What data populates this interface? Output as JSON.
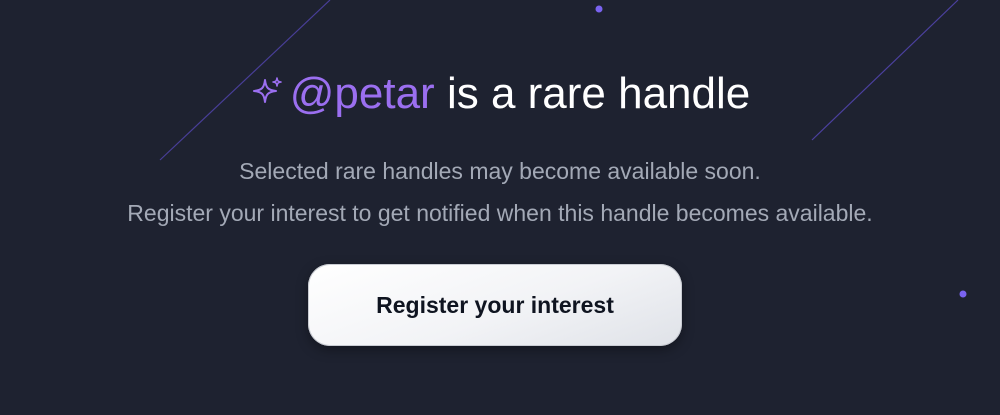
{
  "headline": {
    "icon": "sparkle-icon",
    "handle": "@petar",
    "text": " is a rare handle"
  },
  "description": {
    "line1": "Selected rare handles may become available soon.",
    "line2": "Register your interest to get notified when this handle becomes available."
  },
  "cta": {
    "label": "Register your interest"
  },
  "colors": {
    "background": "#1e2230",
    "accent": "#9b6ff0",
    "headline_text": "#ffffff",
    "body_text": "#a3a9b6",
    "button_bg": "#f2f3f6",
    "button_text": "#0f1420"
  }
}
